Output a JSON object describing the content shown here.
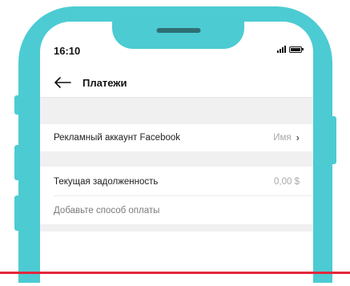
{
  "status_bar": {
    "time": "16:10"
  },
  "header": {
    "title": "Платежи"
  },
  "rows": {
    "ad_account_label": "Рекламный аккаунт Facebook",
    "ad_account_value": "Имя",
    "debt_label": "Текущая задолженность",
    "debt_value": "0,00 $",
    "add_payment_label": "Добавьте способ оплаты"
  },
  "colors": {
    "phone_frame": "#4ccbd3",
    "accent_line": "#e3273b",
    "section_bg": "#f0f0f1"
  },
  "icons": {
    "back": "arrow-left-icon",
    "chevron": "chevron-right-icon",
    "signal": "signal-icon",
    "battery": "battery-icon"
  }
}
